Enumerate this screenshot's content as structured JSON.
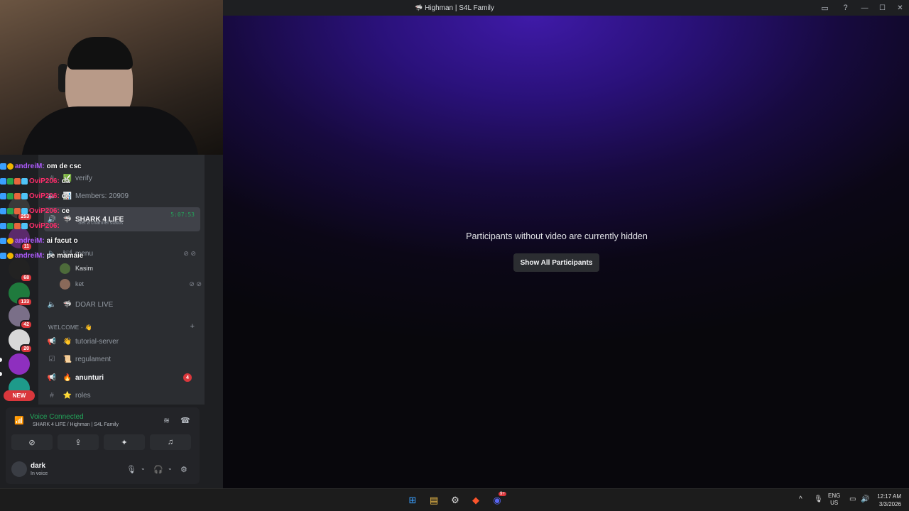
{
  "window": {
    "title": "Highman | S4L Family",
    "inbox_icon": "inbox-icon",
    "help_icon": "help-icon"
  },
  "server_rail": {
    "servers": [
      {
        "name": "server-1",
        "color": "#3a3a3a",
        "badge": "253"
      },
      {
        "name": "server-2",
        "color": "#5b2a6b",
        "badge": "11"
      },
      {
        "name": "server-wow",
        "color": "#222222",
        "badge": "68"
      },
      {
        "name": "server-green",
        "color": "#1f7a3d",
        "badge": "133"
      },
      {
        "name": "server-anime",
        "color": "#7a6f88",
        "badge": "42"
      },
      {
        "name": "server-white",
        "color": "#d8d8d8",
        "badge": "20"
      },
      {
        "name": "server-purple",
        "color": "#8e2fbf",
        "badge": ""
      },
      {
        "name": "server-teal",
        "color": "#1e9a8a",
        "badge": ""
      }
    ],
    "new_label": "NEW"
  },
  "channels": {
    "verify_label": "verify",
    "members_label": "Members: 20909",
    "active_channel": {
      "name": "SHARK 4 LIFE",
      "timer": "5:07:53",
      "status": "Set a channel status"
    },
    "menu_label": "menu",
    "users": [
      {
        "name": "Kasim",
        "color": "#4d6b3a"
      },
      {
        "name": "ket",
        "color": "#8a6a5a"
      }
    ],
    "doar_live": "DOAR LIVE",
    "category_welcome": "WELCOME - 👋",
    "text_channels": [
      {
        "name": "tutorial-server",
        "emoji": "👋",
        "icon": "announcement-icon",
        "bold": false
      },
      {
        "name": "regulament",
        "emoji": "📜",
        "icon": "rules-icon",
        "bold": false
      },
      {
        "name": "anunturi",
        "emoji": "🔥",
        "icon": "announcement-icon",
        "bold": true,
        "ping": "4"
      },
      {
        "name": "roles",
        "emoji": "⭐",
        "icon": "hash-icon",
        "bold": false
      }
    ]
  },
  "chat": [
    {
      "user": "andreiM:",
      "color": "#b05cff",
      "msg": "om de csc"
    },
    {
      "user": "OviP206:",
      "color": "#ff2d6b",
      "msg": "da"
    },
    {
      "user": "OviP206:",
      "color": "#ff2d6b",
      "msg": "de"
    },
    {
      "user": "OviP206:",
      "color": "#ff2d6b",
      "msg": "ce"
    },
    {
      "user": "OviP206:",
      "color": "#ff2d6b",
      "msg": ""
    },
    {
      "user": "andreiM:",
      "color": "#b05cff",
      "msg": "ai facut o"
    },
    {
      "user": "andreiM:",
      "color": "#b05cff",
      "msg": "pe mamaie"
    }
  ],
  "voice": {
    "title": "Voice Connected",
    "subtitle": "SHARK 4 LIFE / Highman | S4L Family"
  },
  "user": {
    "name": "dark",
    "status": "In voice"
  },
  "stage": {
    "message": "Participants without video are currently hidden",
    "button": "Show All Participants"
  },
  "taskbar": {
    "lang_top": "ENG",
    "lang_bottom": "US",
    "time": "12:17 AM",
    "date": "3/3/2026",
    "discord_badge": "9+"
  },
  "colors": {
    "accent_green": "#23a55a",
    "danger_red": "#da373c",
    "stage_purple": "#3f1aa8"
  }
}
